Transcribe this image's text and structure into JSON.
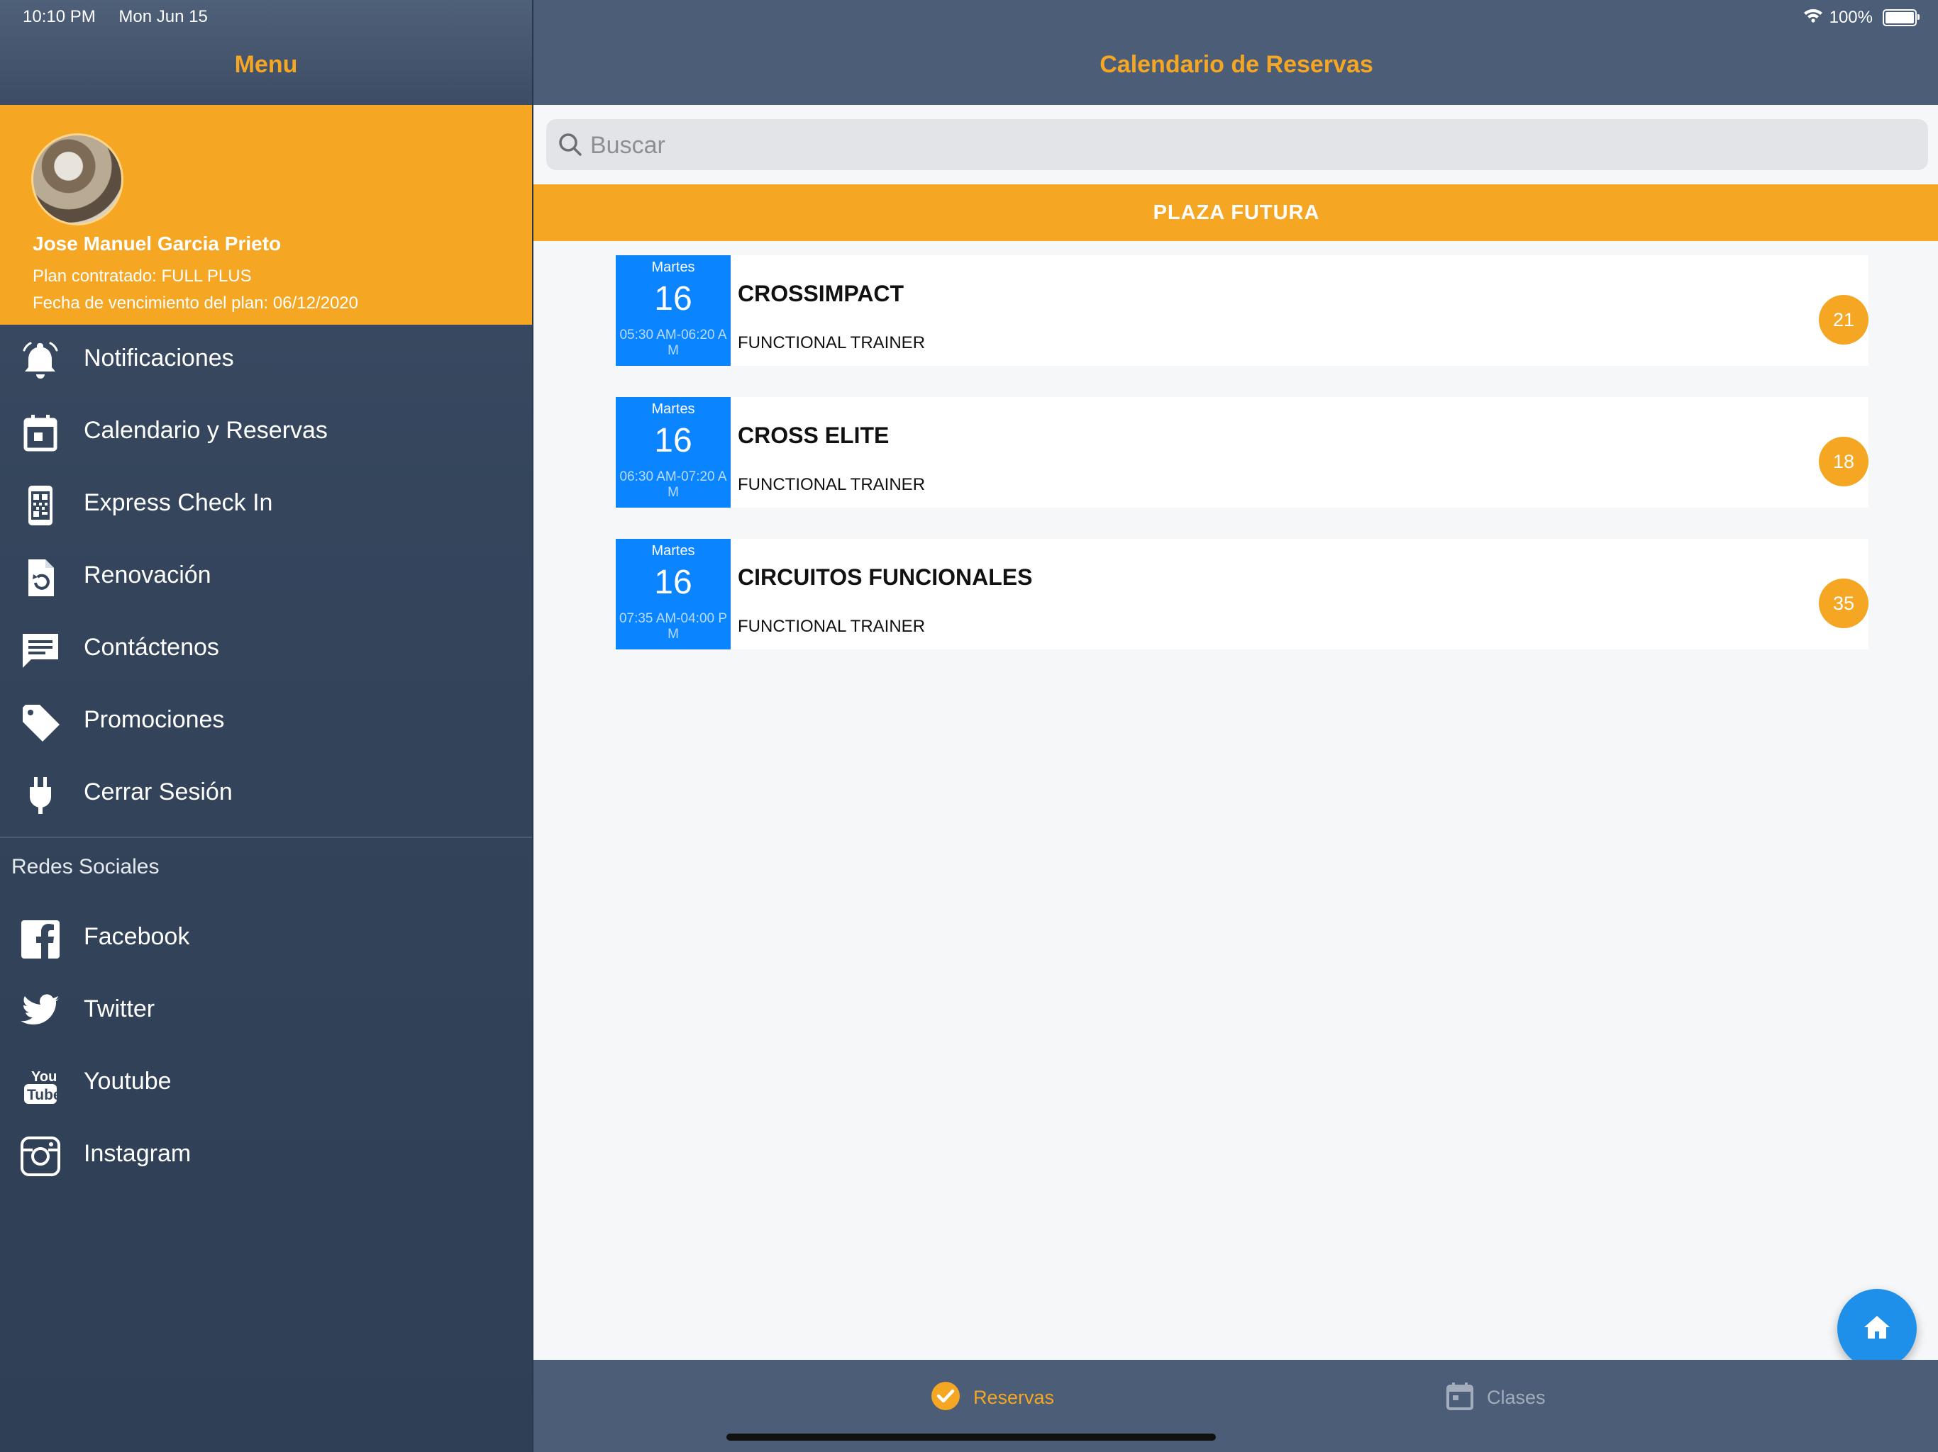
{
  "status_bar": {
    "time": "10:10 PM",
    "date": "Mon Jun 15",
    "battery": "100%"
  },
  "sidebar": {
    "title": "Menu",
    "profile": {
      "name": "Jose Manuel Garcia Prieto",
      "plan": "Plan contratado: FULL PLUS",
      "expiry": "Fecha de vencimiento del plan: 06/12/2020"
    },
    "items": [
      {
        "label": "Notificaciones",
        "icon": "bell-icon"
      },
      {
        "label": "Calendario y Reservas",
        "icon": "calendar-icon"
      },
      {
        "label": "Express Check In",
        "icon": "qr-phone-icon"
      },
      {
        "label": "Renovación",
        "icon": "renew-document-icon"
      },
      {
        "label": "Contáctenos",
        "icon": "chat-icon"
      },
      {
        "label": "Promociones",
        "icon": "tag-icon"
      },
      {
        "label": "Cerrar Sesión",
        "icon": "plug-icon"
      }
    ],
    "social_header": "Redes Sociales",
    "social": [
      {
        "label": "Facebook",
        "icon": "facebook-icon"
      },
      {
        "label": "Twitter",
        "icon": "twitter-icon"
      },
      {
        "label": "Youtube",
        "icon": "youtube-icon"
      },
      {
        "label": "Instagram",
        "icon": "instagram-icon"
      }
    ]
  },
  "main": {
    "title": "Calendario de Reservas",
    "search": {
      "placeholder": "Buscar",
      "value": ""
    },
    "section": "PLAZA FUTURA",
    "classes": [
      {
        "day": "Martes",
        "date": "16",
        "time": "05:30 AM-06:20 AM",
        "name": "CROSSIMPACT",
        "trainer": "FUNCTIONAL TRAINER",
        "count": "21"
      },
      {
        "day": "Martes",
        "date": "16",
        "time": "06:30 AM-07:20 AM",
        "name": "CROSS ELITE",
        "trainer": "FUNCTIONAL TRAINER",
        "count": "18"
      },
      {
        "day": "Martes",
        "date": "16",
        "time": "07:35 AM-04:00 PM",
        "name": "CIRCUITOS FUNCIONALES",
        "trainer": "FUNCTIONAL TRAINER",
        "count": "35"
      }
    ]
  },
  "tabbar": {
    "tabs": [
      {
        "label": "Reservas",
        "icon": "check-circle-icon",
        "active": true
      },
      {
        "label": "Clases",
        "icon": "calendar-icon",
        "active": false
      }
    ]
  },
  "colors": {
    "accent": "#f5a623",
    "sidebar": "#34455c",
    "topbar": "#4b5d77",
    "date_blue": "#0a84ff",
    "fab": "#1e90ea",
    "inactive_tab": "#a3acba"
  }
}
